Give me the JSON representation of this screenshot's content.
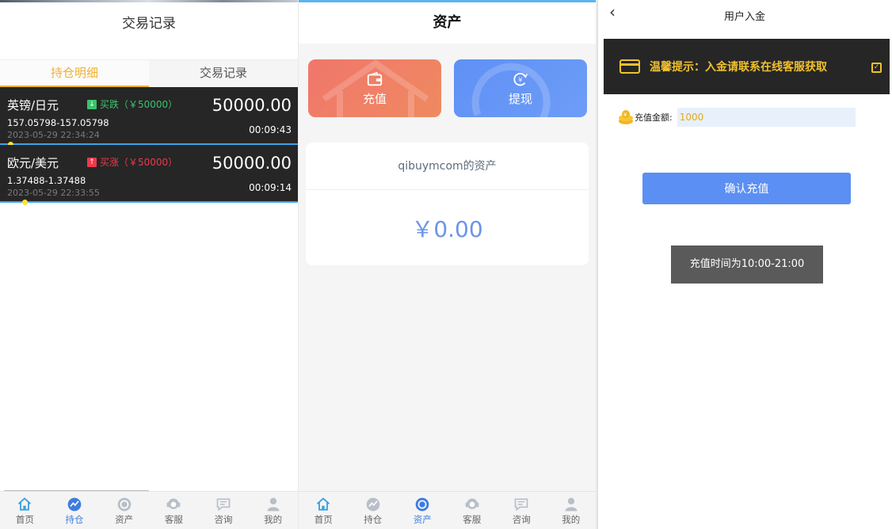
{
  "positions_screen": {
    "title": "交易记录",
    "tabs": [
      {
        "label": "持仓明细",
        "active": true
      },
      {
        "label": "交易记录",
        "active": false
      }
    ],
    "orders": [
      {
        "pair": "英镑/日元",
        "direction": "买跌（￥50000）",
        "direction_type": "down",
        "amount": "50000.00",
        "price_range": "157.05798-157.05798",
        "timestamp": "2023-05-29 22:34:24",
        "countdown": "00:09:43",
        "progress": 0.02
      },
      {
        "pair": "欧元/美元",
        "direction": "买涨（￥50000）",
        "direction_type": "up",
        "amount": "50000.00",
        "price_range": "1.37488-1.37488",
        "timestamp": "2023-05-29 22:33:55",
        "countdown": "00:09:14",
        "progress": 0.07
      }
    ],
    "active_nav": 1
  },
  "nav": [
    {
      "label": "首页",
      "icon": "home-icon"
    },
    {
      "label": "持仓",
      "icon": "trend-icon"
    },
    {
      "label": "资产",
      "icon": "coin-icon"
    },
    {
      "label": "客服",
      "icon": "support-icon"
    },
    {
      "label": "咨询",
      "icon": "chat-icon"
    },
    {
      "label": "我的",
      "icon": "user-icon"
    }
  ],
  "assets_screen": {
    "title": "资产",
    "recharge_label": "充值",
    "withdraw_label": "提现",
    "owner_label": "qibuymcom的资产",
    "balance": "￥0.00",
    "active_nav": 2
  },
  "deposit_screen": {
    "title": "用户入金",
    "tip": "温馨提示：入金请联系在线客服获取",
    "amount_label": "充值金额:",
    "amount_value": "1000",
    "confirm_label": "确认充值",
    "hours_notice": "充值时间为10:00-21:00"
  },
  "colors": {
    "accent_gold": "#f0b032",
    "accent_blue": "#3f7ce0",
    "down_green": "#39c46a",
    "up_red": "#f0384a"
  }
}
